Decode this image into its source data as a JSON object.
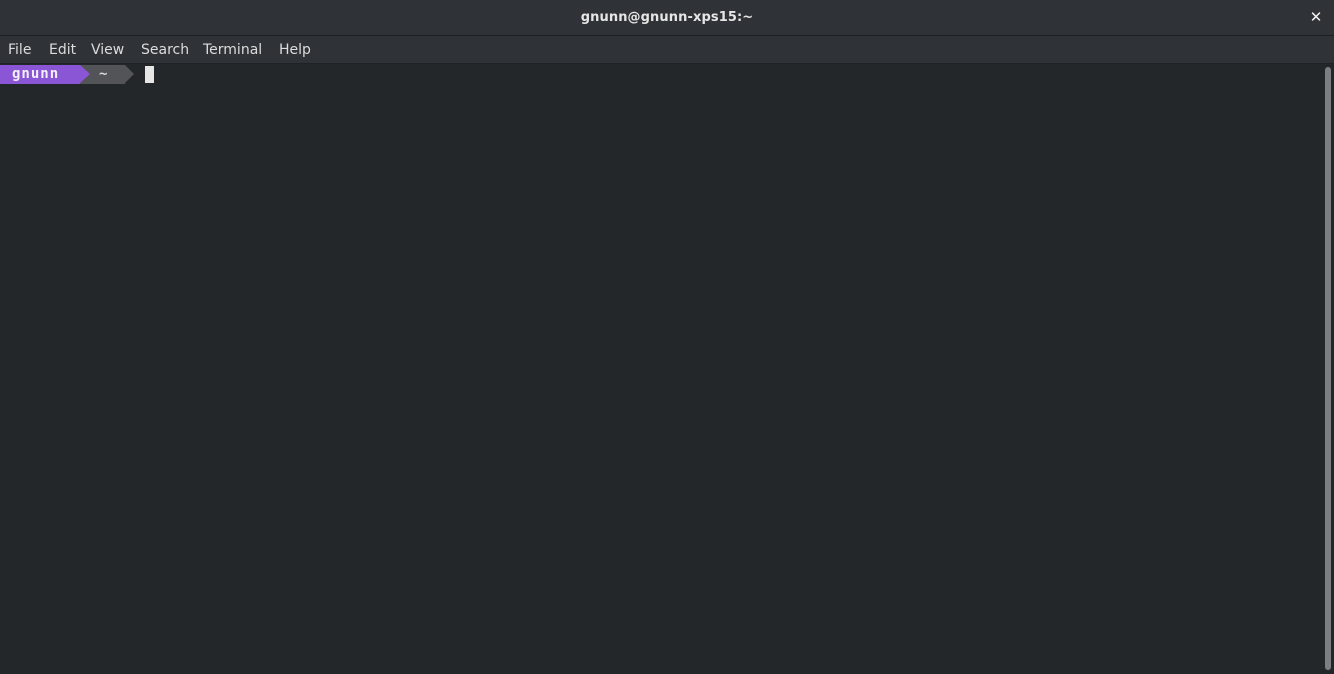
{
  "window": {
    "title": "gnunn@gnunn-xps15:~",
    "close_symbol": "✕"
  },
  "menu": {
    "items": [
      "File",
      "Edit",
      "View",
      "Search",
      "Terminal",
      "Help"
    ]
  },
  "prompt": {
    "user": "gnunn",
    "directory": "~",
    "user_segment_color": "#8a56d6",
    "dir_segment_color": "#525458"
  },
  "icons": {
    "close": "close-icon"
  }
}
